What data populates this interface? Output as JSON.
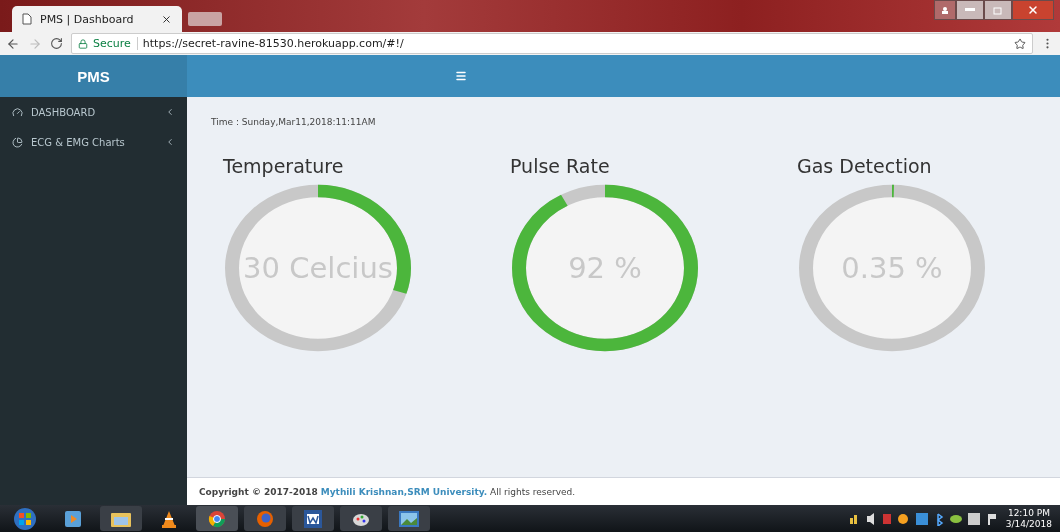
{
  "browser": {
    "tab_title": "PMS | Dashboard",
    "secure_label": "Secure",
    "url": "https://secret-ravine-81530.herokuapp.com/#!/"
  },
  "sidebar": {
    "logo": "PMS",
    "items": [
      {
        "label": "DASHBOARD",
        "kind": "dashboard"
      },
      {
        "label": "ECG & EMG Charts",
        "kind": "chart"
      }
    ]
  },
  "time": "Time : Sunday,Mar11,2018:11:11AM",
  "gauges": [
    {
      "title": "Temperature",
      "value": "30 Celcius",
      "level": 0.3
    },
    {
      "title": "Pulse Rate",
      "value": "92 %",
      "level": 0.92
    },
    {
      "title": "Gas Detection",
      "value": "0.35 %",
      "level": 0.0035
    }
  ],
  "footer": {
    "prefix": "Copyright © 2017-2018",
    "link": "Mythili Krishnan,SRM University.",
    "suffix": "All rights reserved."
  },
  "clock": {
    "time": "12:10 PM",
    "date": "3/14/2018"
  }
}
